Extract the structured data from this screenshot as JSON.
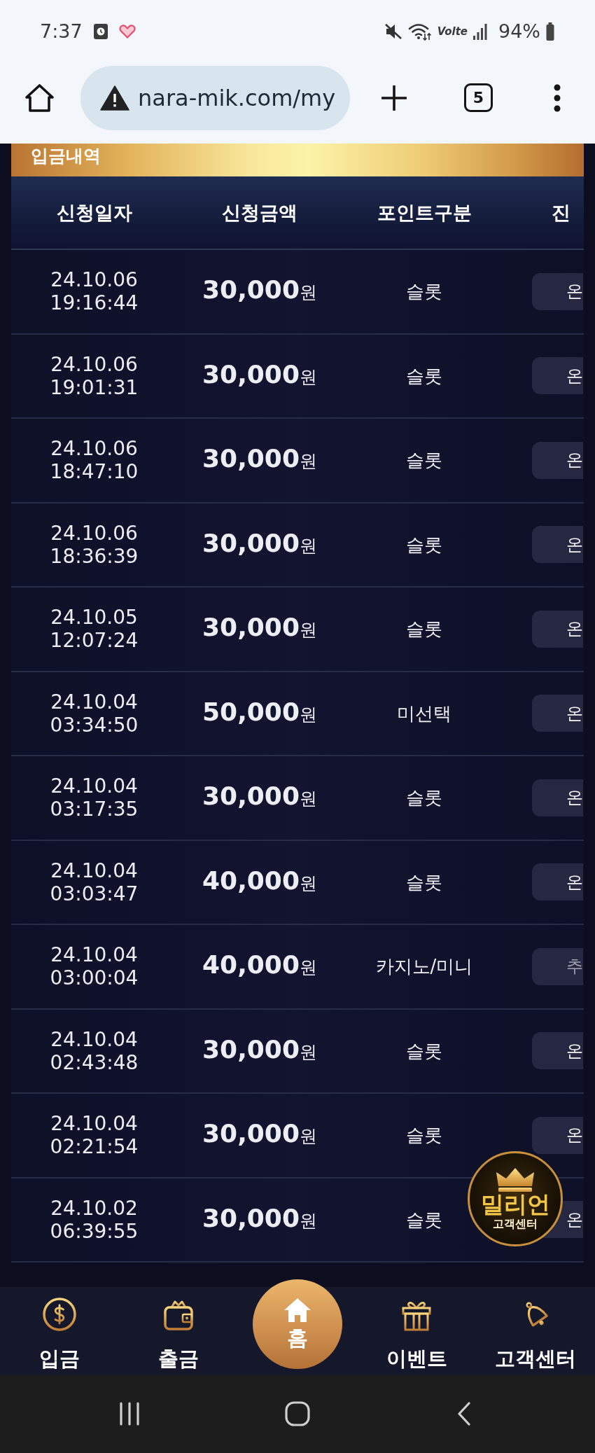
{
  "status_bar": {
    "time": "7:37",
    "network": "Volte",
    "battery": "94%"
  },
  "browser": {
    "url": "nara-mik.com/my",
    "tab_count": "5"
  },
  "section": {
    "title": "입금내역"
  },
  "table": {
    "columns": [
      "신청일자",
      "신청금액",
      "포인트구분",
      "진"
    ],
    "rows": [
      {
        "date": "24.10.06",
        "time": "19:16:44",
        "amount": "**30,000**원",
        "category": "슬롯",
        "status": {
          "label": "온",
          "color": "#f2f3f7"
        }
      },
      {
        "date": "24.10.06",
        "time": "19:01:31",
        "amount": "**30,000**원",
        "category": "슬롯",
        "status": {
          "label": "온",
          "color": "#f2f3f7"
        }
      },
      {
        "date": "24.10.06",
        "time": "18:47:10",
        "amount": "**30,000**원",
        "category": "슬롯",
        "status": {
          "label": "온",
          "color": "#f2f3f7"
        }
      },
      {
        "date": "24.10.06",
        "time": "18:36:39",
        "amount": "**30,000**원",
        "category": "슬롯",
        "status": {
          "label": "온",
          "color": "#f2f3f7"
        }
      },
      {
        "date": "24.10.05",
        "time": "12:07:24",
        "amount": "**30,000**원",
        "category": "슬롯",
        "status": {
          "label": "온",
          "color": "#f2f3f7"
        }
      },
      {
        "date": "24.10.04",
        "time": "03:34:50",
        "amount": "**50,000**원",
        "category": "미선택",
        "status": {
          "label": "온",
          "color": "#f2f3f7"
        }
      },
      {
        "date": "24.10.04",
        "time": "03:17:35",
        "amount": "**30,000**원",
        "category": "슬롯",
        "status": {
          "label": "온",
          "color": "#f2f3f7"
        }
      },
      {
        "date": "24.10.04",
        "time": "03:03:47",
        "amount": "**40,000**원",
        "category": "슬롯",
        "status": {
          "label": "온",
          "color": "#f2f3f7"
        }
      },
      {
        "date": "24.10.04",
        "time": "03:00:04",
        "amount": "**40,000**원",
        "category": "카지노/미니",
        "status": {
          "label": "추",
          "color": "#a3a4b2"
        }
      },
      {
        "date": "24.10.04",
        "time": "02:43:48",
        "amount": "**30,000**원",
        "category": "슬롯",
        "status": {
          "label": "온",
          "color": "#f2f3f7"
        }
      },
      {
        "date": "24.10.04",
        "time": "02:21:54",
        "amount": "**30,000**원",
        "category": "슬롯",
        "status": {
          "label": "온",
          "color": "#f2f3f7"
        }
      },
      {
        "date": "24.10.02",
        "time": "06:39:55",
        "amount": "**30,000**원",
        "category": "슬롯",
        "status": {
          "label": "온",
          "color": "#f2f3f7"
        }
      }
    ]
  },
  "floating_badge": {
    "title": "밀리언",
    "subtitle": "고객센터"
  },
  "bottom_nav": {
    "items": [
      {
        "label": "입금",
        "kind": "coin"
      },
      {
        "label": "출금",
        "kind": "wallet"
      },
      {
        "label": "홈",
        "kind": "home"
      },
      {
        "label": "이벤트",
        "kind": "gift"
      },
      {
        "label": "고객센터",
        "kind": "bell"
      }
    ]
  }
}
